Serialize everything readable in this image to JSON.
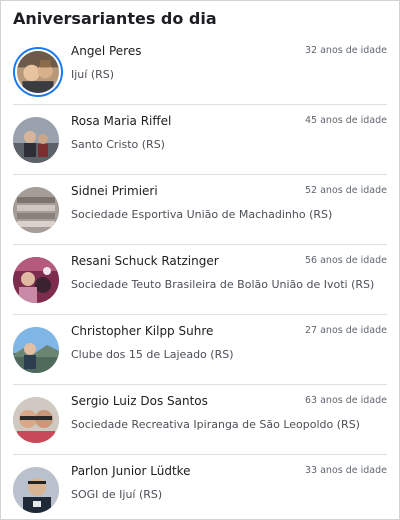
{
  "title": "Aniversariantes do dia",
  "people": [
    {
      "name": "Angel Peres",
      "age": "32 anos de idade",
      "club": "Ijuí (RS)"
    },
    {
      "name": "Rosa Maria Riffel",
      "age": "45 anos de idade",
      "club": "Santo Cristo (RS)"
    },
    {
      "name": "Sidnei Primieri",
      "age": "52 anos de idade",
      "club": "Sociedade Esportiva União de Machadinho (RS)"
    },
    {
      "name": "Resani Schuck Ratzinger",
      "age": "56 anos de idade",
      "club": "Sociedade Teuto Brasileira de Bolão União de Ivoti (RS)"
    },
    {
      "name": "Christopher Kilpp Suhre",
      "age": "27 anos de idade",
      "club": "Clube dos 15 de Lajeado (RS)"
    },
    {
      "name": "Sergio Luiz Dos Santos",
      "age": "63 anos de idade",
      "club": "Sociedade Recreativa Ipiranga de São Leopoldo (RS)"
    },
    {
      "name": "Parlon Junior Lüdtke",
      "age": "33 anos de idade",
      "club": "SOGI de Ijuí (RS)"
    }
  ],
  "colors": {
    "accent": "#1877f2",
    "divider": "#dcdfe3"
  }
}
